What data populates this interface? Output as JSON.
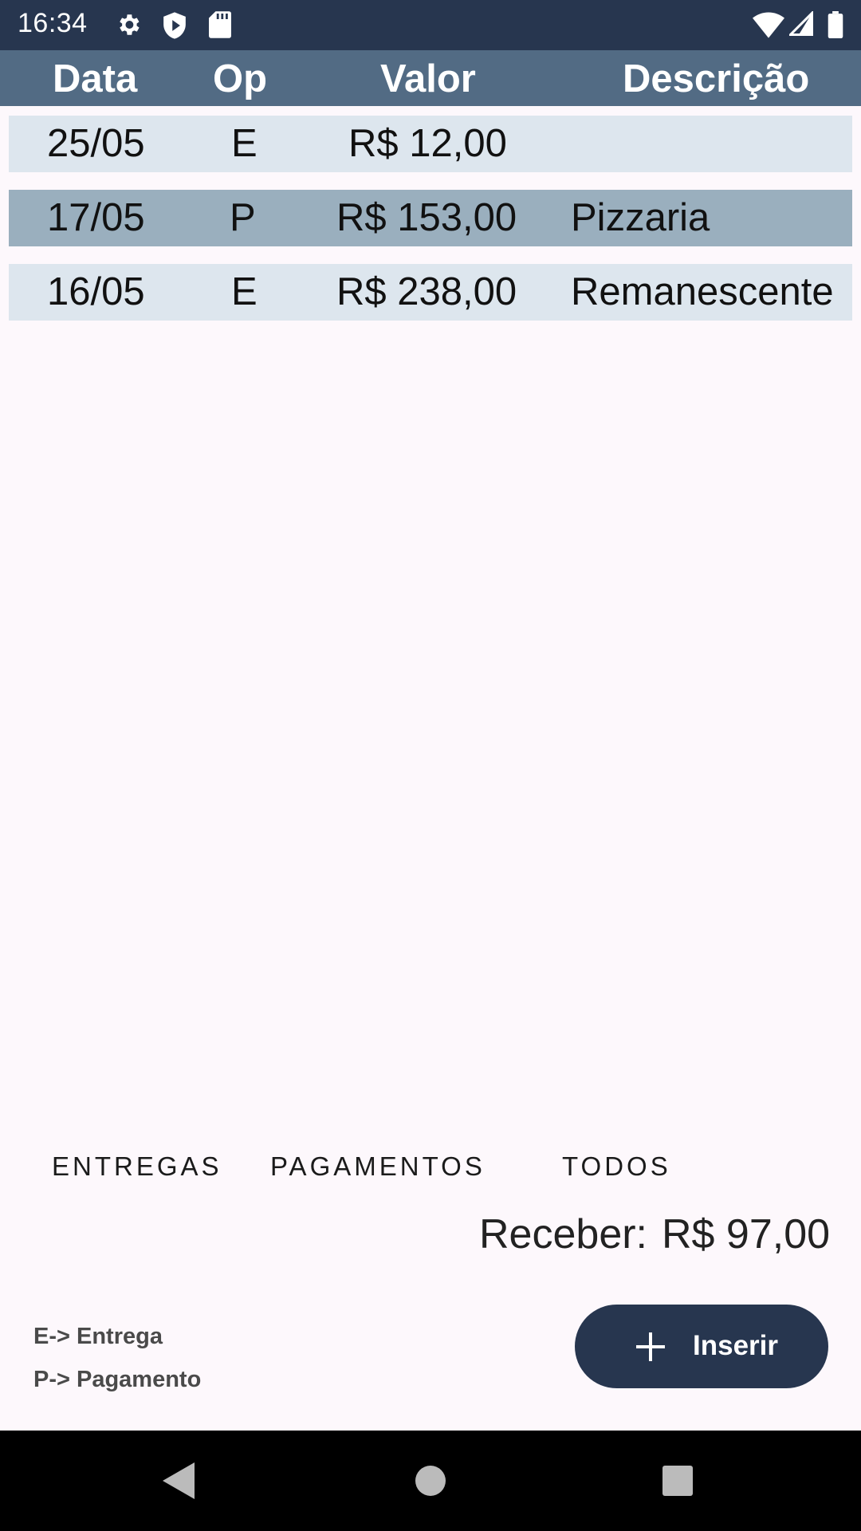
{
  "status_bar": {
    "time": "16:34",
    "left_icons": [
      "gear-icon",
      "shield-icon",
      "sd-card-icon"
    ],
    "right_icons": [
      "wifi-icon",
      "cell-signal-icon",
      "battery-icon"
    ]
  },
  "table": {
    "headers": [
      "Data",
      "Op",
      "Valor",
      "Descrição"
    ],
    "rows": [
      {
        "data": "25/05",
        "op": "E",
        "valor": "R$ 12,00",
        "descricao": ""
      },
      {
        "data": "17/05",
        "op": "P",
        "valor": "R$ 153,00",
        "descricao": "Pizzaria"
      },
      {
        "data": "16/05",
        "op": "E",
        "valor": "R$ 238,00",
        "descricao": "Remanescente"
      }
    ]
  },
  "filters": {
    "entregas": "ENTREGAS",
    "pagamentos": "PAGAMENTOS",
    "todos": "TODOS"
  },
  "summary": {
    "label": "Receber:",
    "value": "R$ 97,00"
  },
  "legend": {
    "e": "E-> Entrega",
    "p": "P-> Pagamento"
  },
  "fab": {
    "icon": "plus-icon",
    "label": "Inserir"
  },
  "nav_bar": {
    "buttons": [
      "back-icon",
      "home-icon",
      "recents-icon"
    ]
  },
  "colors": {
    "status_bar": "#27364f",
    "header": "#526b84",
    "row_light": "#dde6ee",
    "row_dark": "#9aafbe",
    "fab": "#27364f",
    "background": "#fdf8fc"
  }
}
